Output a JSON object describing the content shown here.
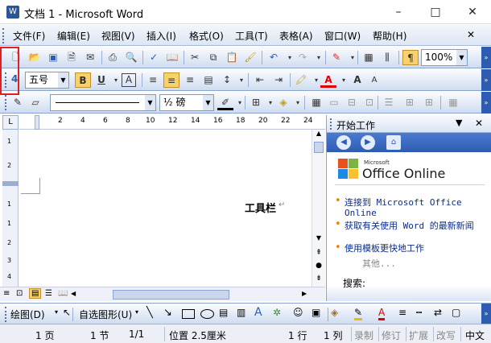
{
  "title": {
    "text": "文档 1 - Microsoft Word",
    "app_icon": "W"
  },
  "window_buttons": {
    "minimize": "–",
    "maximize": "□",
    "close": "✕"
  },
  "menu": [
    "文件(F)",
    "编辑(E)",
    "视图(V)",
    "插入(I)",
    "格式(O)",
    "工具(T)",
    "表格(A)",
    "窗口(W)",
    "帮助(H)"
  ],
  "standard_toolbar": {
    "zoom": "100%"
  },
  "format_toolbar": {
    "style_prefix": "4",
    "font_size": "五号",
    "bold": "B",
    "underline": "U",
    "char_a": "A",
    "font_color_a": "A",
    "grow_a": "A",
    "shrink_a": "A"
  },
  "table_toolbar": {
    "line_weight": "½ 磅"
  },
  "ruler": {
    "ticks": [
      "2",
      "4",
      "6",
      "8",
      "10",
      "12",
      "14",
      "16",
      "18",
      "20",
      "22",
      "24"
    ],
    "left_tab": "L"
  },
  "vruler": {
    "ticks": [
      "1",
      "2",
      "1",
      "1",
      "2",
      "3",
      "4"
    ]
  },
  "document": {
    "text": "工具栏",
    "para_mark": "↵"
  },
  "task_pane": {
    "title": "开始工作",
    "logo_small": "Microsoft",
    "logo_text": "Office Online",
    "links": [
      {
        "text": "连接到 Microsoft Office Online"
      },
      {
        "text": "获取有关使用 Word 的最新新闻"
      },
      {
        "text": "使用模板更快地工作"
      }
    ],
    "more": "其他...",
    "search_label": "搜索:"
  },
  "draw_toolbar": {
    "draw_label": "绘图(D)",
    "autoshape_label": "自选图形(U)"
  },
  "status_bar": {
    "page": "1 页",
    "section": "1 节",
    "pages": "1/1",
    "position": "位置 2.5厘米",
    "line": "1 行",
    "column": "1 列",
    "rec": "录制",
    "trk": "修订",
    "ext": "扩展",
    "ovr": "改写",
    "lang": "中文"
  },
  "colors": {
    "accent": "#2f5cb3",
    "toolbar_border": "#8ba3cf",
    "highlight_box": "#e02020",
    "font_color": "#e00000"
  }
}
